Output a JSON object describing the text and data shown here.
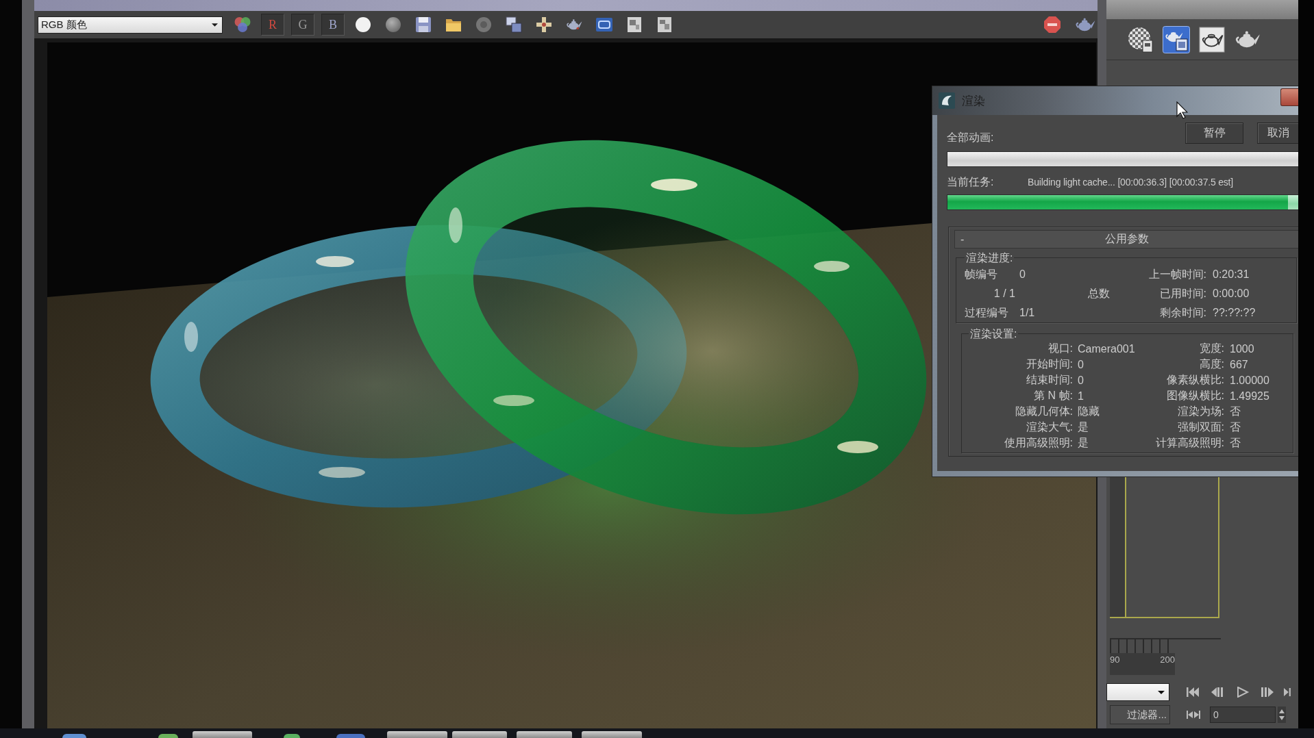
{
  "frame_buffer": {
    "channel_dropdown": {
      "value": "RGB 颜色"
    },
    "channel_buttons": [
      {
        "label": "R",
        "on": true,
        "color": "#d04a40"
      },
      {
        "label": "G",
        "on": true,
        "color": "#9a9a9a"
      },
      {
        "label": "B",
        "on": true,
        "color": "#a0a6cc"
      }
    ]
  },
  "render_dialog": {
    "title": "渲染",
    "overall_label": "全部动画:",
    "buttons": [
      "暂停",
      "取消"
    ],
    "overall_progress": {
      "level": 0
    },
    "task_label": "当前任务:",
    "task_text": "Building light cache... [00:00:36.3] [00:00:37.5 est]",
    "task_progress": {
      "level": 0.97
    },
    "rollout": {
      "sign": "-",
      "title": "公用参数",
      "progress_group": {
        "title": "渲染进度:",
        "rows": [
          {
            "label": "帧编号",
            "value": "0",
            "right_label": "上一帧时间:",
            "right_value": "0:20:31"
          },
          {
            "value": "1 / 1",
            "middle": "总数",
            "right_label": "已用时间:",
            "right_value": "0:00:00"
          },
          {
            "label": "过程编号",
            "value": "1/1",
            "right_label": "剩余时间:",
            "right_value": "??:??:??"
          }
        ]
      },
      "settings_group": {
        "title": "渲染设置:",
        "rows": [
          {
            "label": "视口:",
            "value": "Camera001",
            "right_label": "宽度:",
            "right_value": "1000"
          },
          {
            "label": "开始时间:",
            "value": "0",
            "right_label": "高度:",
            "right_value": "667"
          },
          {
            "label": "结束时间:",
            "value": "0",
            "right_label": "像素纵横比:",
            "right_value": "1.00000"
          },
          {
            "label": "第 N 帧:",
            "value": "1",
            "right_label": "图像纵横比:",
            "right_value": "1.49925"
          },
          {
            "label": "隐藏几何体:",
            "value": "隐藏",
            "right_label": "渲染为场:",
            "right_value": "否"
          },
          {
            "label": "渲染大气:",
            "value": "是",
            "right_label": "强制双面:",
            "right_value": "否"
          },
          {
            "label": "使用高级照明:",
            "value": "是",
            "right_label": "计算高级照明:",
            "right_value": "否"
          }
        ]
      }
    }
  },
  "command_panel": {
    "render_tools": [
      {
        "kind": "checker-sphere",
        "selected": false
      },
      {
        "kind": "frame-window",
        "selected": true
      },
      {
        "kind": "boxed-teapot",
        "selected": false
      },
      {
        "kind": "teapot",
        "selected": false
      }
    ],
    "ruler_labels": [
      "90",
      "200"
    ],
    "filter_button": "过滤器...",
    "frame_field": {
      "value": "0"
    }
  }
}
